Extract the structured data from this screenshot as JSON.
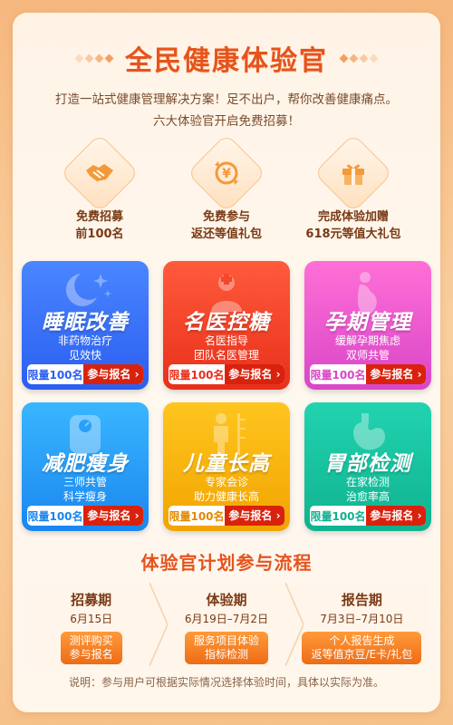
{
  "header": {
    "title": "全民健康体验官",
    "intro_line1": "打造一站式健康管理解决方案！足不出户，帮你改善健康痛点。",
    "intro_line2": "六大体验官开启免费招募！"
  },
  "benefits": [
    {
      "icon": "handshake-icon",
      "line1": "免费招募",
      "line2": "前100名"
    },
    {
      "icon": "yuan-refund-icon",
      "line1": "免费参与",
      "line2": "返还等值礼包"
    },
    {
      "icon": "gift-box-icon",
      "line1": "完成体验加赠",
      "line2": "618元等值大礼包"
    }
  ],
  "programs": [
    {
      "name": "睡眠改善",
      "desc1": "非药物治疗",
      "desc2": "见效快",
      "limit": "限量100名",
      "join": "参与报名",
      "color": "#2b5ef0",
      "icon": "moon-stars-icon"
    },
    {
      "name": "名医控糖",
      "desc1": "名医指导",
      "desc2": "团队名医管理",
      "limit": "限量100名",
      "join": "参与报名",
      "color": "#e8301a",
      "icon": "doctor-icon"
    },
    {
      "name": "孕期管理",
      "desc1": "缓解孕期焦虑",
      "desc2": "双师共管",
      "limit": "限量100名",
      "join": "参与报名",
      "color": "#d946c8",
      "icon": "pregnant-icon"
    },
    {
      "name": "减肥瘦身",
      "desc1": "三师共管",
      "desc2": "科学瘦身",
      "limit": "限量100名",
      "join": "参与报名",
      "color": "#1a86f0",
      "icon": "scale-icon"
    },
    {
      "name": "儿童长高",
      "desc1": "专家会诊",
      "desc2": "助力健康长高",
      "limit": "限量100名",
      "join": "参与报名",
      "color": "#f2a400",
      "icon": "child-height-icon"
    },
    {
      "name": "胃部检测",
      "desc1": "在家检测",
      "desc2": "治愈率高",
      "limit": "限量100名",
      "join": "参与报名",
      "color": "#10b28f",
      "icon": "stomach-icon"
    }
  ],
  "flow": {
    "title": "体验官计划参与流程",
    "steps": [
      {
        "title": "招募期",
        "date": "6月15日",
        "pill1": "测评购买",
        "pill2": "参与报名"
      },
      {
        "title": "体验期",
        "date": "6月19日–7月2日",
        "pill1": "服务项目体验",
        "pill2": "指标检测"
      },
      {
        "title": "报告期",
        "date": "7月3日–7月10日",
        "pill1": "个人报告生成",
        "pill2": "返等值京豆/E卡/礼包"
      }
    ]
  },
  "footer_note": "说明：参与用户可根据实际情况选择体验时间，具体以实际为准。"
}
